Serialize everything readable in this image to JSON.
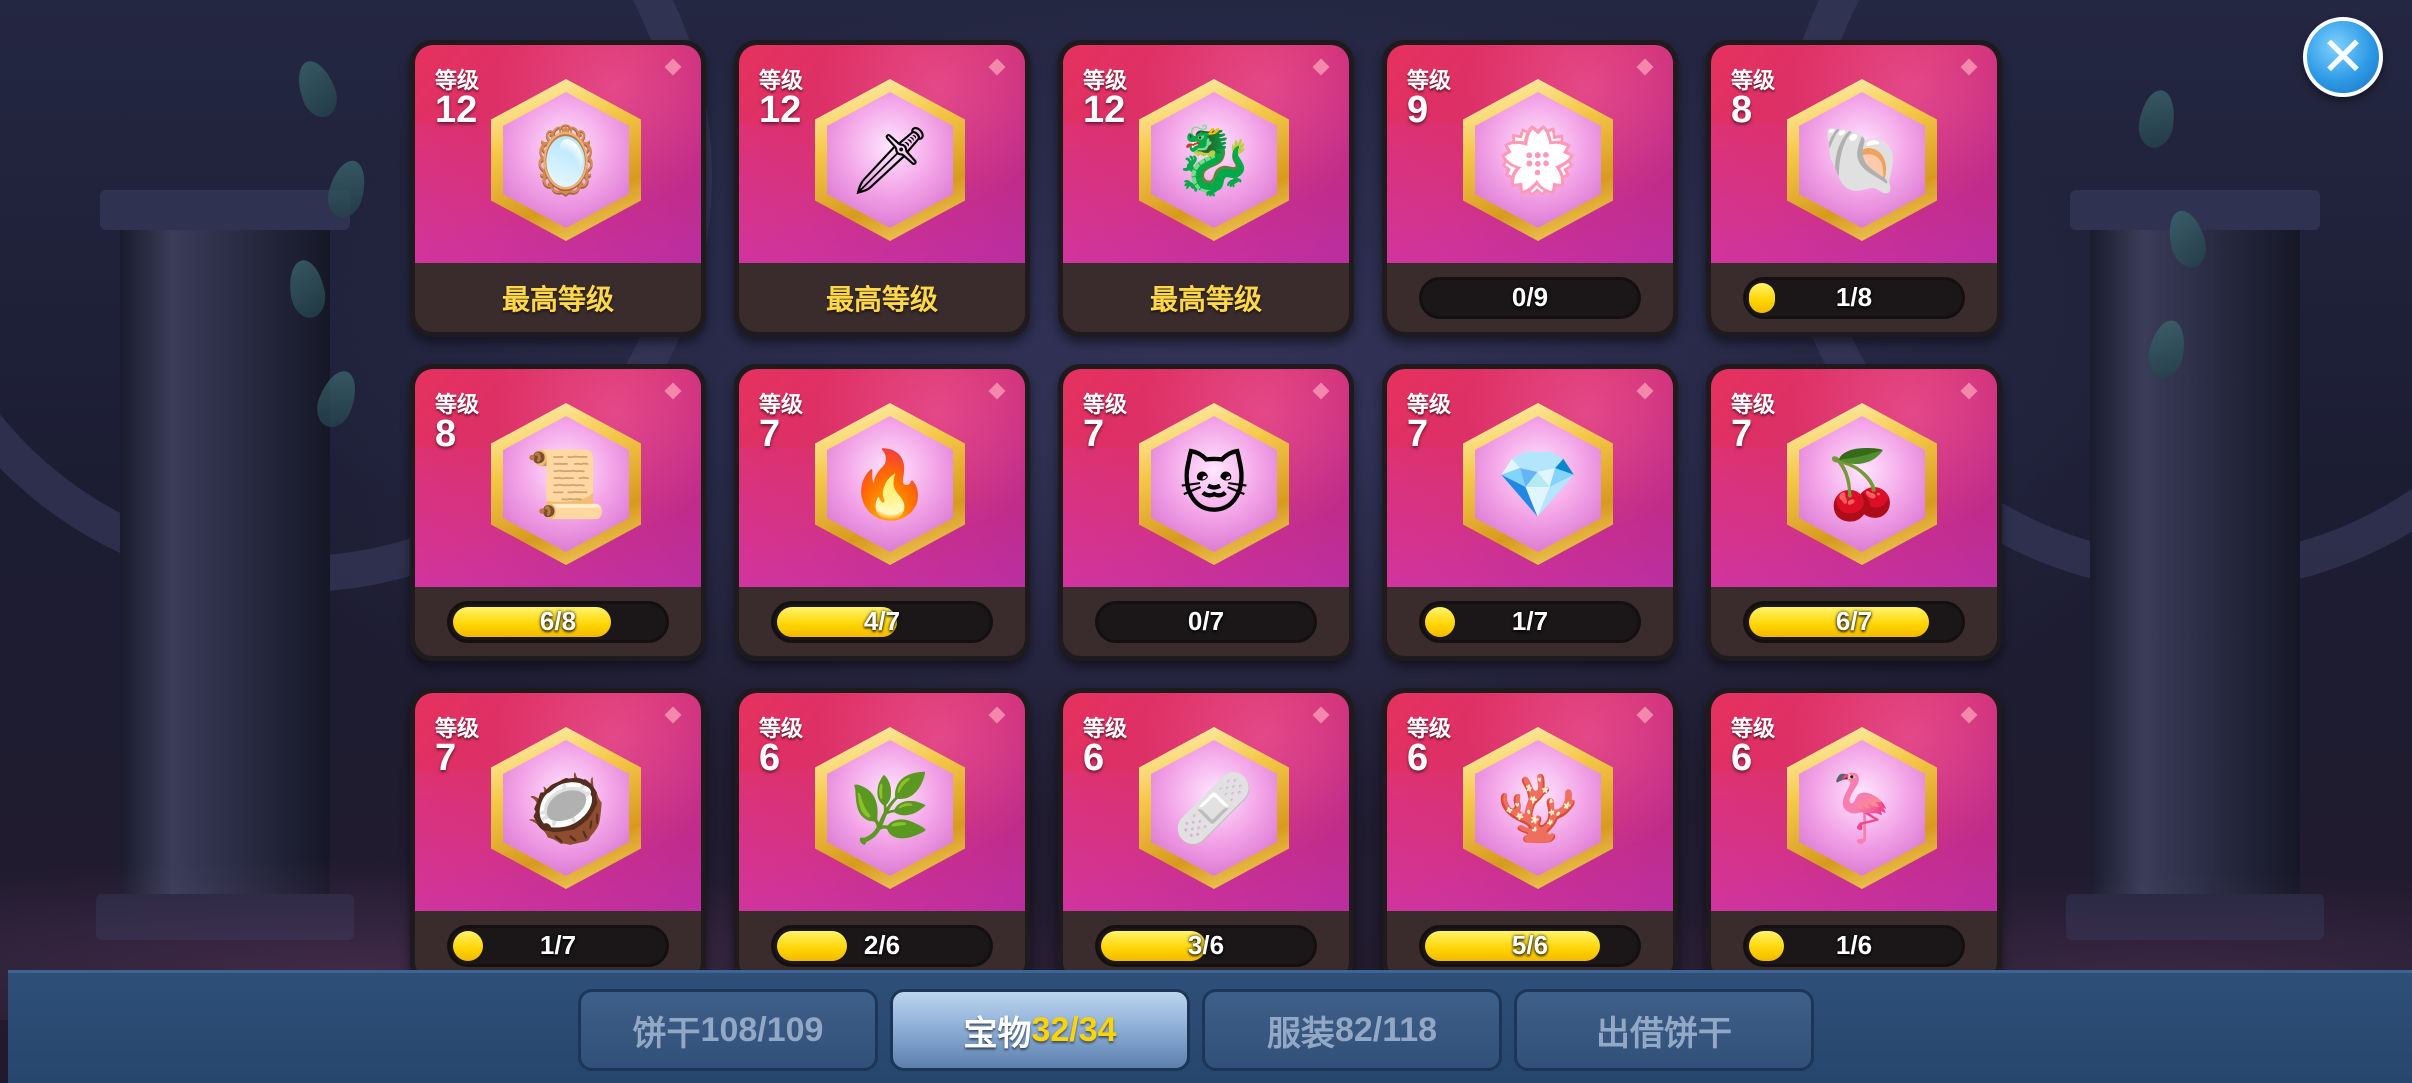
{
  "close": {
    "icon": "close-icon",
    "glyph": "✕"
  },
  "labels": {
    "level": "等级",
    "max_level": "最高等级"
  },
  "treasures": [
    {
      "level": "12",
      "max": true,
      "icon": "golden-mirror-icon",
      "glyph": "🪞"
    },
    {
      "level": "12",
      "max": true,
      "icon": "silver-claw-icon",
      "glyph": "🗡"
    },
    {
      "level": "12",
      "max": true,
      "icon": "dragon-horn-icon",
      "glyph": "🐉"
    },
    {
      "level": "9",
      "max": false,
      "progress": "0/9",
      "fill": 0.0,
      "icon": "pearl-wreath-icon",
      "glyph": "💮"
    },
    {
      "level": "8",
      "max": false,
      "progress": "1/8",
      "fill": 0.125,
      "icon": "dragon-shell-icon",
      "glyph": "🐚"
    },
    {
      "level": "8",
      "max": false,
      "progress": "6/8",
      "fill": 0.75,
      "icon": "old-scroll-icon",
      "glyph": "📜"
    },
    {
      "level": "7",
      "max": false,
      "progress": "4/7",
      "fill": 0.571,
      "icon": "fire-crown-icon",
      "glyph": "🔥"
    },
    {
      "level": "7",
      "max": false,
      "progress": "0/7",
      "fill": 0.0,
      "icon": "jelly-cat-icon",
      "glyph": "🐱"
    },
    {
      "level": "7",
      "max": false,
      "progress": "1/7",
      "fill": 0.143,
      "icon": "blue-sack-icon",
      "glyph": "💎"
    },
    {
      "level": "7",
      "max": false,
      "progress": "6/7",
      "fill": 0.857,
      "icon": "holly-berry-icon",
      "glyph": "🍒"
    },
    {
      "level": "7",
      "max": false,
      "progress": "1/7",
      "fill": 0.143,
      "icon": "cocoa-pod-icon",
      "glyph": "🥥"
    },
    {
      "level": "6",
      "max": false,
      "progress": "2/6",
      "fill": 0.333,
      "icon": "ice-branch-icon",
      "glyph": "🌿"
    },
    {
      "level": "6",
      "max": false,
      "progress": "3/6",
      "fill": 0.5,
      "icon": "bandage-roll-icon",
      "glyph": "🩹"
    },
    {
      "level": "6",
      "max": false,
      "progress": "5/6",
      "fill": 0.833,
      "icon": "coral-reef-icon",
      "glyph": "🪸"
    },
    {
      "level": "6",
      "max": false,
      "progress": "1/6",
      "fill": 0.167,
      "icon": "flamingo-ring-icon",
      "glyph": "🦩"
    }
  ],
  "tabs": [
    {
      "label": "饼干",
      "count": "108/109",
      "active": false
    },
    {
      "label": "宝物",
      "count": "32/34",
      "active": true
    },
    {
      "label": "服装",
      "count": "82/118",
      "active": false
    },
    {
      "label": "出借饼干",
      "count": "",
      "active": false
    }
  ]
}
